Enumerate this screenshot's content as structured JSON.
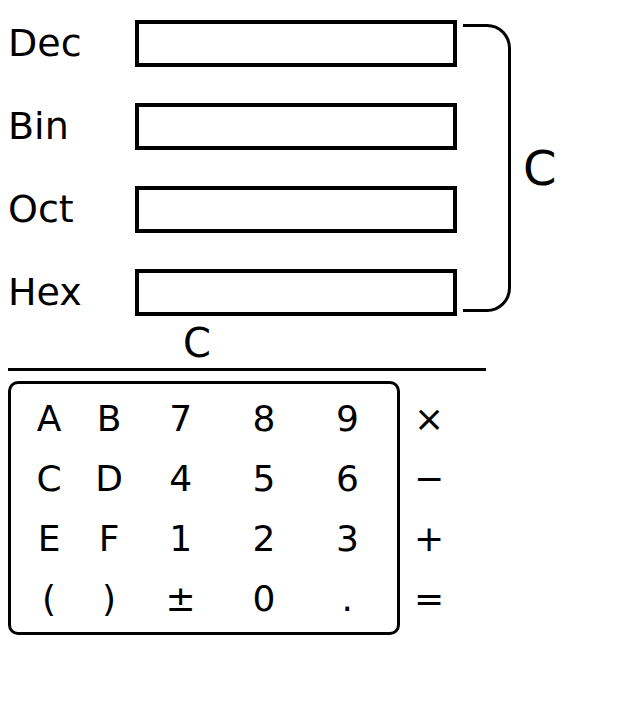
{
  "window": {
    "title": ""
  },
  "fields": [
    {
      "label": "Dec",
      "value": ""
    },
    {
      "label": "Bin",
      "value": ""
    },
    {
      "label": "Oct",
      "value": ""
    },
    {
      "label": "Hex",
      "value": ""
    }
  ],
  "bracket_label": "C",
  "clear_label": "C",
  "keypad": [
    [
      "A",
      "B",
      "7",
      "8",
      "9"
    ],
    [
      "C",
      "D",
      "4",
      "5",
      "6"
    ],
    [
      "E",
      "F",
      "1",
      "2",
      "3"
    ],
    [
      "(",
      ")",
      "±",
      "0",
      "."
    ]
  ],
  "operators": [
    "×",
    "−",
    "+",
    "="
  ]
}
